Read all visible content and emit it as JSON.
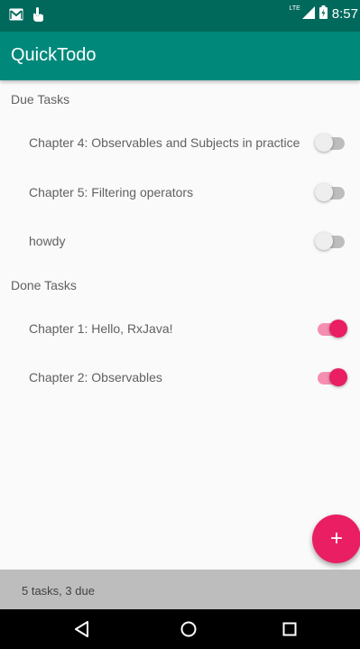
{
  "status_bar": {
    "time": "8:57",
    "network": "LTE",
    "icons": [
      "gmail-icon",
      "touch-icon",
      "signal-icon",
      "battery-icon"
    ]
  },
  "app_bar": {
    "title": "QuickTodo"
  },
  "sections": [
    {
      "header": "Due Tasks",
      "tasks": [
        {
          "label": "Chapter 4: Observables and Subjects in practice",
          "done": false
        },
        {
          "label": "Chapter 5: Filtering operators",
          "done": false
        },
        {
          "label": "howdy",
          "done": false
        }
      ]
    },
    {
      "header": "Done Tasks",
      "tasks": [
        {
          "label": "Chapter 1: Hello, RxJava!",
          "done": true
        },
        {
          "label": "Chapter 2: Observables",
          "done": true
        }
      ]
    }
  ],
  "fab": {
    "icon": "add-icon",
    "label": "+"
  },
  "footer": {
    "summary": "5 tasks, 3 due"
  },
  "nav_bar": {
    "icons": [
      "back-icon",
      "home-icon",
      "recents-icon"
    ]
  },
  "colors": {
    "primary": "#00897b",
    "primary_dark": "#00695c",
    "accent": "#e91e63"
  }
}
